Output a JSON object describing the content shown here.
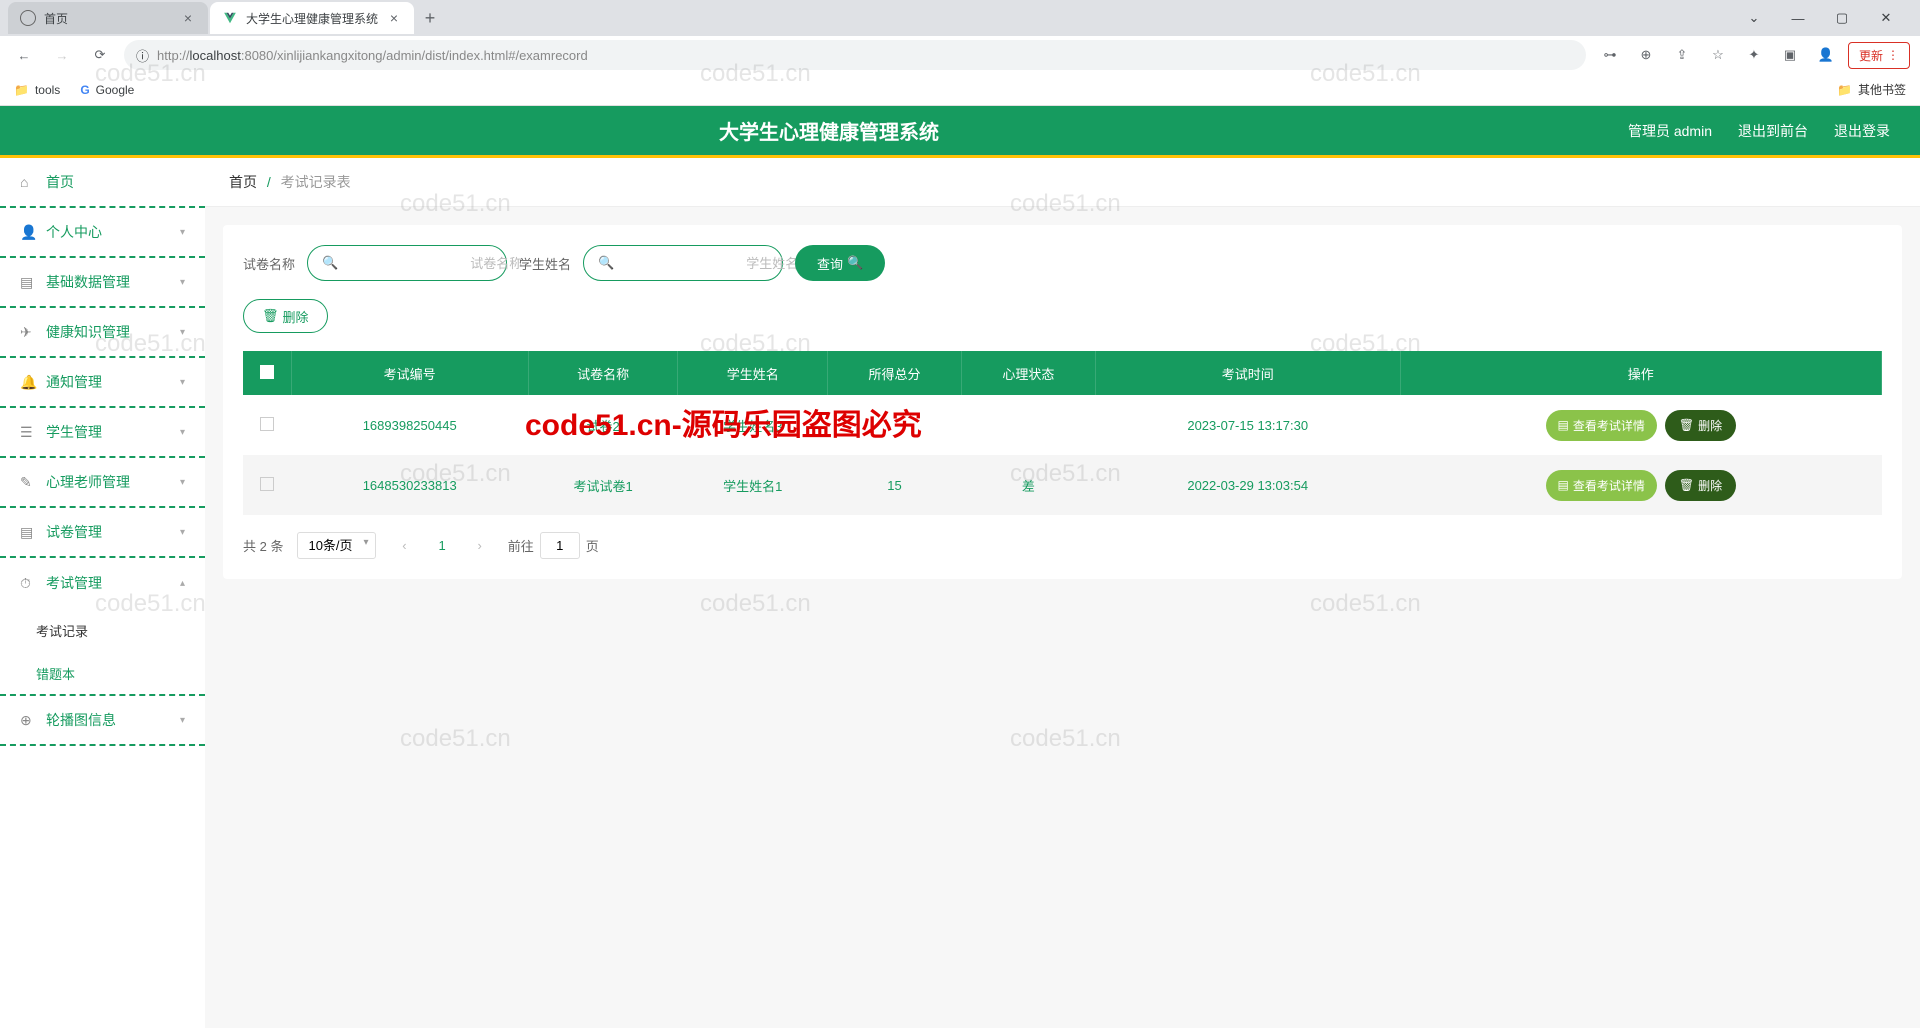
{
  "browser": {
    "tabs": [
      {
        "title": "首页",
        "active": false
      },
      {
        "title": "大学生心理健康管理系统",
        "active": true
      }
    ],
    "url_prefix": "http://",
    "url_host": "localhost",
    "url_rest": ":8080/xinlijiankangxitong/admin/dist/index.html#/examrecord",
    "update": "更新",
    "bookmarks": {
      "tools": "tools",
      "google": "Google",
      "other": "其他书签"
    }
  },
  "app": {
    "title": "大学生心理健康管理系统",
    "header": {
      "admin": "管理员 admin",
      "logout_front": "退出到前台",
      "logout": "退出登录"
    }
  },
  "sidebar": {
    "home": "首页",
    "items": [
      {
        "label": "个人中心",
        "icon": "user"
      },
      {
        "label": "基础数据管理",
        "icon": "database"
      },
      {
        "label": "健康知识管理",
        "icon": "send"
      },
      {
        "label": "通知管理",
        "icon": "bell"
      },
      {
        "label": "学生管理",
        "icon": "student"
      },
      {
        "label": "心理老师管理",
        "icon": "teacher"
      },
      {
        "label": "试卷管理",
        "icon": "paper"
      }
    ],
    "exam": "考试管理",
    "exam_sub": [
      {
        "label": "考试记录",
        "active": true
      },
      {
        "label": "错题本",
        "active": false
      }
    ],
    "carousel": "轮播图信息"
  },
  "breadcrumb": {
    "home": "首页",
    "current": "考试记录表"
  },
  "search": {
    "label1": "试卷名称",
    "placeholder1": "试卷名称",
    "label2": "学生姓名",
    "placeholder2": "学生姓名",
    "query": "查询",
    "delete": "删除"
  },
  "table": {
    "headers": [
      "考试编号",
      "试卷名称",
      "学生姓名",
      "所得总分",
      "心理状态",
      "考试时间",
      "操作"
    ],
    "rows": [
      {
        "id": "1689398250445",
        "paper": "试卷2",
        "student": "学生姓名3",
        "score": "",
        "status": "",
        "time": "2023-07-15 13:17:30"
      },
      {
        "id": "1648530233813",
        "paper": "考试试卷1",
        "student": "学生姓名1",
        "score": "15",
        "status": "差",
        "time": "2022-03-29 13:03:54"
      }
    ],
    "actions": {
      "detail": "查看考试详情",
      "delete": "删除"
    }
  },
  "pagination": {
    "total": "共 2 条",
    "per_page": "10条/页",
    "current": "1",
    "jump_prefix": "前往",
    "jump_value": "1",
    "jump_suffix": "页"
  },
  "watermark": "code51.cn",
  "watermark_red": "code51.cn-源码乐园盗图必究"
}
